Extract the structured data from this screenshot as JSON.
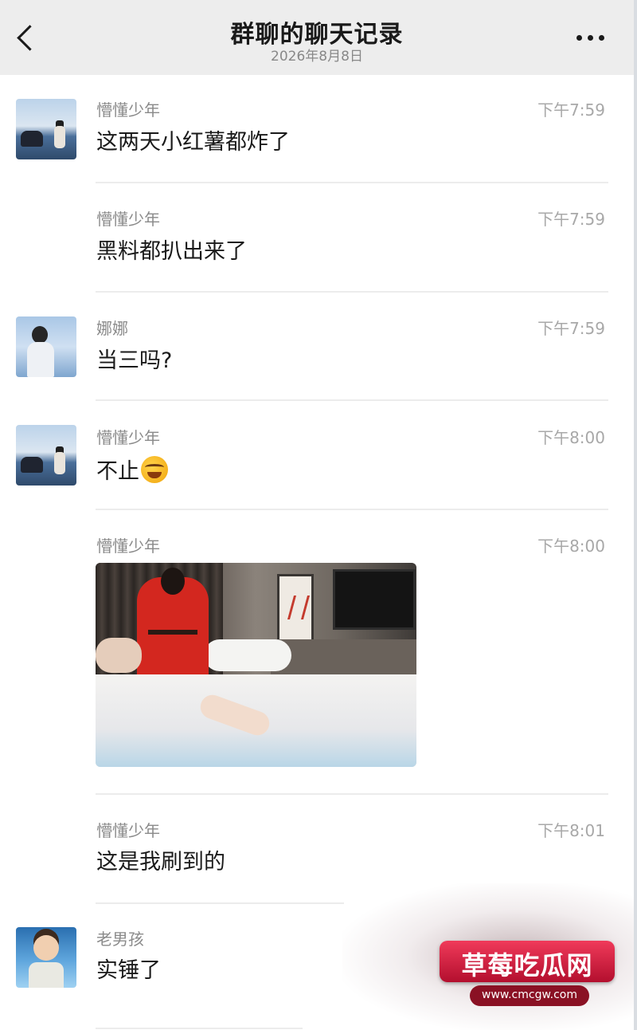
{
  "header": {
    "title": "群聊的聊天记录",
    "date": "2026年8月8日"
  },
  "messages": [
    {
      "sender": "懵懂少年",
      "time": "下午7:59",
      "text": "这两天小红薯都炸了"
    },
    {
      "sender": "懵懂少年",
      "time": "下午7:59",
      "text": "黑料都扒出来了"
    },
    {
      "sender": "娜娜",
      "time": "下午7:59",
      "text": "当三吗?"
    },
    {
      "sender": "懵懂少年",
      "time": "下午8:00",
      "text": "不止"
    },
    {
      "sender": "懵懂少年",
      "time": "下午8:00"
    },
    {
      "sender": "懵懂少年",
      "time": "下午8:01",
      "text": "这是我刷到的"
    },
    {
      "sender": "老男孩",
      "text": "实锤了"
    }
  ],
  "watermark": {
    "logo_text": "草莓吃瓜网",
    "url": "www.cmcgw.com"
  }
}
